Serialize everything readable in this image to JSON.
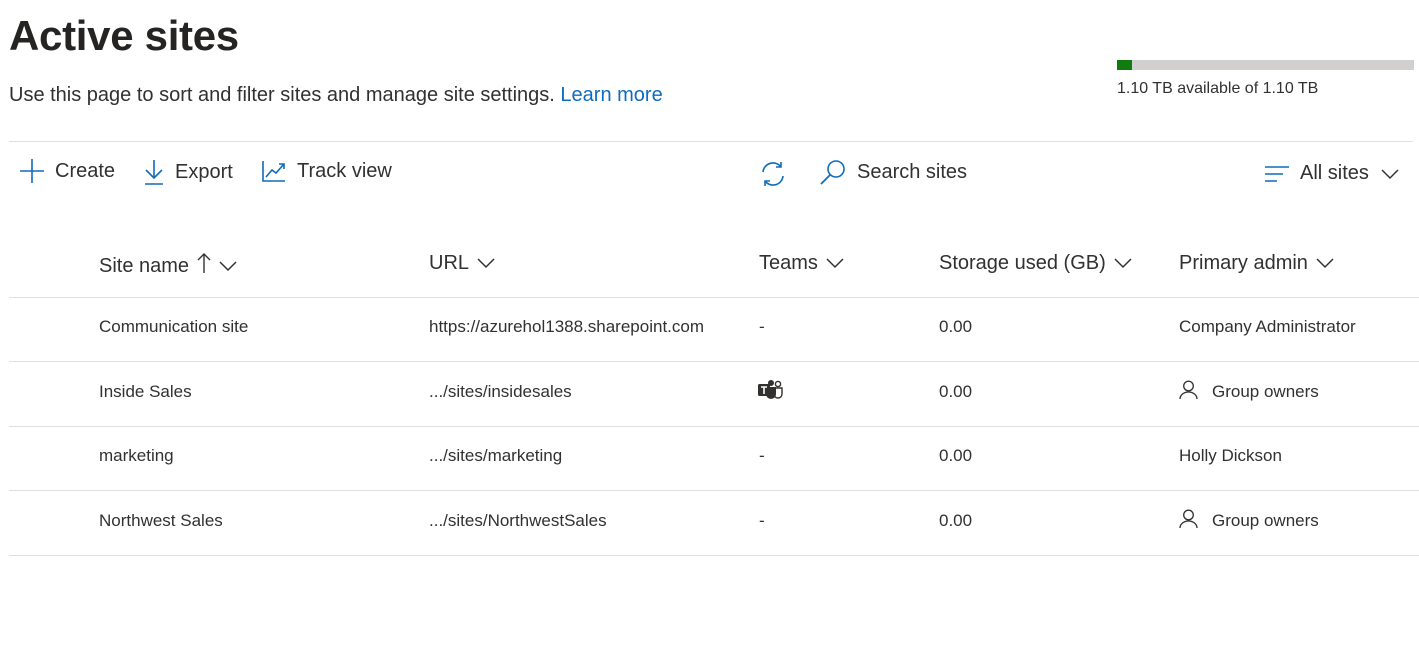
{
  "header": {
    "title": "Active sites",
    "description": "Use this page to sort and filter sites and manage site settings.",
    "learn_more": "Learn more"
  },
  "storage": {
    "text": "1.10 TB available of 1.10 TB",
    "used_fraction": 0.05,
    "fill_color": "#107c10"
  },
  "toolbar": {
    "create": "Create",
    "export": "Export",
    "track_view": "Track view",
    "search_placeholder": "Search sites",
    "view_filter": "All sites"
  },
  "table": {
    "columns": [
      "Site name",
      "URL",
      "Teams",
      "Storage used (GB)",
      "Primary admin"
    ],
    "sorted_column": "Site name",
    "sort_direction": "ascending",
    "rows": [
      {
        "site_name": "Communication site",
        "url": "https://azurehol1388.sharepoint.com",
        "teams": "-",
        "teams_icon": false,
        "storage": "0.00",
        "admin": "Company Administrator",
        "admin_icon": false
      },
      {
        "site_name": "Inside Sales",
        "url": ".../sites/insidesales",
        "teams": "",
        "teams_icon": true,
        "storage": "0.00",
        "admin": "Group owners",
        "admin_icon": true
      },
      {
        "site_name": "marketing",
        "url": ".../sites/marketing",
        "teams": "-",
        "teams_icon": false,
        "storage": "0.00",
        "admin": "Holly Dickson",
        "admin_icon": false
      },
      {
        "site_name": "Northwest Sales",
        "url": ".../sites/NorthwestSales",
        "teams": "-",
        "teams_icon": false,
        "storage": "0.00",
        "admin": "Group owners",
        "admin_icon": true
      }
    ]
  },
  "colors": {
    "accent": "#0f6cbd",
    "text": "#323130",
    "divider": "#e1dfdd"
  }
}
